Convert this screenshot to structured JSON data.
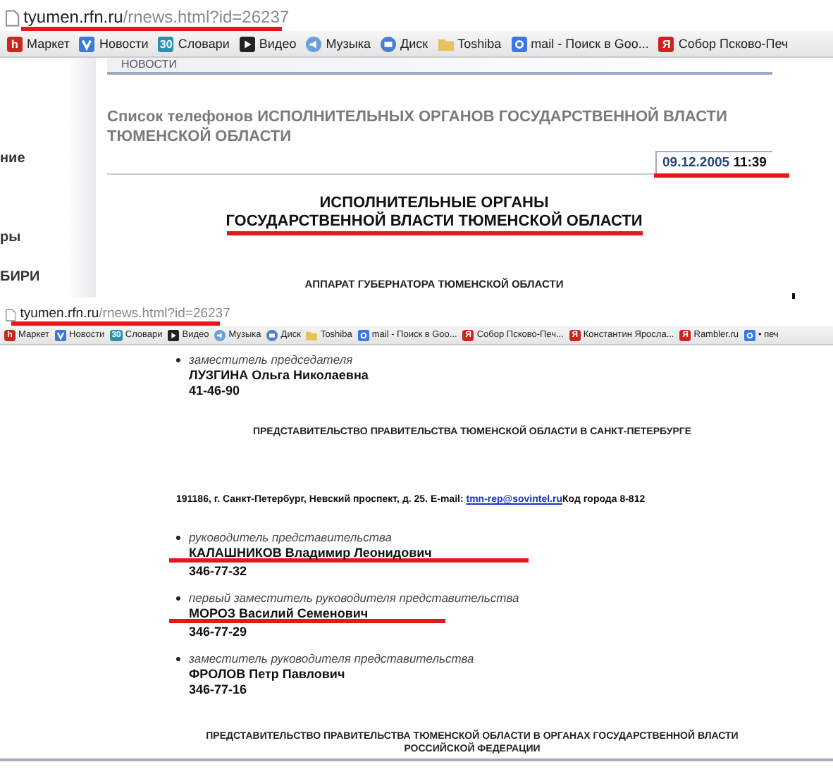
{
  "captures": [
    {
      "address": {
        "host": "tyumen.rfn.ru",
        "path": "/rnews.html?id=26237",
        "highlighted": true
      },
      "bookmarks": [
        {
          "label": "Маркет",
          "kind": "badge",
          "badge": "h",
          "color": "#c8281e"
        },
        {
          "label": "Новости",
          "kind": "check",
          "color": "#3a7bd5"
        },
        {
          "label": "Словари",
          "kind": "badge",
          "badge": "30",
          "color": "#2a8fb0"
        },
        {
          "label": "Видео",
          "kind": "play",
          "color": "#222222"
        },
        {
          "label": "Музыка",
          "kind": "speaker",
          "color": "#6a9fd8"
        },
        {
          "label": "Диск",
          "kind": "mail",
          "color": "#4a7fd0"
        },
        {
          "label": "Toshiba",
          "kind": "folder",
          "color": "#e8c060"
        },
        {
          "label": "mail - Поиск в Goo...",
          "kind": "google",
          "color": "#3b78e7"
        },
        {
          "label": "Собор Псково-Печ",
          "kind": "badge",
          "badge": "Я",
          "color": "#d02020"
        }
      ],
      "sidebar": {
        "items": [
          "ние",
          "ры",
          "БИРИ"
        ]
      },
      "section_tab": "НОВОСТИ",
      "page_title": "Список телефонов ИСПОЛНИТЕЛЬНЫХ ОРГАНОВ ГОСУДАРСТВЕННОЙ ВЛАСТИ ТЮМЕНСКОЙ ОБЛАСТИ",
      "date": {
        "day": "09.12.2005",
        "time": "11:39",
        "highlighted": true
      },
      "heading": [
        {
          "text": "ИСПОЛНИТЕЛЬНЫЕ ОРГАНЫ",
          "highlighted": false
        },
        {
          "text": "ГОСУДАРСТВЕННОЙ ВЛАСТИ ТЮМЕНСКОЙ ОБЛАСТИ",
          "highlighted": true
        }
      ],
      "subheading": "АППАРАТ ГУБЕРНАТОРА ТЮМЕНСКОЙ ОБЛАСТИ"
    },
    {
      "address": {
        "host": "tyumen.rfn.ru",
        "path": "/rnews.html?id=26237",
        "highlighted": true
      },
      "bookmarks": [
        {
          "label": "Маркет",
          "kind": "badge",
          "badge": "h",
          "color": "#c8281e"
        },
        {
          "label": "Новости",
          "kind": "check",
          "color": "#3a7bd5"
        },
        {
          "label": "Словари",
          "kind": "badge",
          "badge": "30",
          "color": "#2a8fb0"
        },
        {
          "label": "Видео",
          "kind": "play",
          "color": "#222222"
        },
        {
          "label": "Музыка",
          "kind": "speaker",
          "color": "#6a9fd8"
        },
        {
          "label": "Диск",
          "kind": "mail",
          "color": "#4a7fd0"
        },
        {
          "label": "Toshiba",
          "kind": "folder",
          "color": "#e8c060"
        },
        {
          "label": "mail - Поиск в Goo...",
          "kind": "google",
          "color": "#3b78e7"
        },
        {
          "label": "Собор Псково-Печ...",
          "kind": "badge",
          "badge": "Я",
          "color": "#d02020"
        },
        {
          "label": "Константин Яросла...",
          "kind": "badge",
          "badge": "Я",
          "color": "#d02020"
        },
        {
          "label": "Rambler.ru",
          "kind": "badge",
          "badge": "Я",
          "color": "#d02020"
        },
        {
          "label": "• печ",
          "kind": "google",
          "color": "#3b78e7"
        }
      ],
      "contacts": [
        {
          "role": "заместитель председателя",
          "name": "ЛУЗГИНА Ольга Николаевна",
          "phone": "41-46-90",
          "highlighted": false
        }
      ],
      "section_heading": "ПРЕДСТАВИТЕЛЬСТВО ПРАВИТЕЛЬСТВА ТЮМЕНСКОЙ ОБЛАСТИ В САНКТ-ПЕТЕРБУРГЕ",
      "address_line": {
        "text": "191186, г. Санкт-Петербург, Невский проспект, д. 25. E-mail: ",
        "email": "tmn-rep@sovintel.ru",
        "suffix": "Код города 8-812"
      },
      "representatives": [
        {
          "role": "руководитель представительства",
          "name": "КАЛАШНИКОВ Владимир Леонидович",
          "phone": "346-77-32",
          "highlighted": true
        },
        {
          "role": "первый заместитель руководителя представительства",
          "name": "МОРОЗ Василий Семенович",
          "phone": "346-77-29",
          "highlighted": true
        },
        {
          "role": "заместитель руководителя представительства",
          "name": "ФРОЛОВ Петр Павлович",
          "phone": "346-77-16",
          "highlighted": false
        }
      ],
      "final_heading": "ПРЕДСТАВИТЕЛЬСТВО ПРАВИТЕЛЬСТВА ТЮМЕНСКОЙ ОБЛАСТИ В ОРГАНАХ ГОСУДАРСТВЕННОЙ ВЛАСТИ РОССИЙСКОЙ ФЕДЕРАЦИИ"
    }
  ]
}
